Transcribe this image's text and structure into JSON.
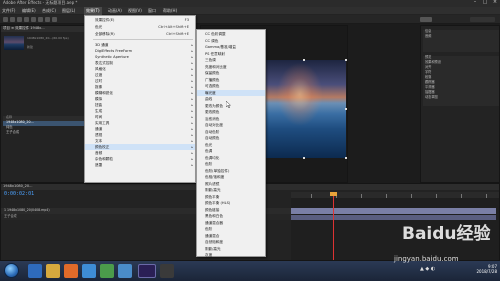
{
  "titlebar": {
    "title": "Adobe After Effects - 无标题项目.aep *"
  },
  "menubar": {
    "items": [
      "文件(F)",
      "编辑(E)",
      "合成(C)",
      "图层(L)",
      "效果(T)",
      "动画(A)",
      "视图(V)",
      "窗口",
      "帮助(H)"
    ],
    "active_index": 4
  },
  "project": {
    "header": "项目 ≡   效果控件 1948x...",
    "info": "1948x1080_20...(60.00 fps)",
    "title_line": "新建",
    "rows_header": "名称",
    "rows": [
      "1948x1080_20...",
      "纯色",
      "王子合成"
    ]
  },
  "timeline": {
    "timecode": "0:00:02:01",
    "tab": "1948x1080_20...",
    "layer1": "1  1948x1080_20(0408.mp4)",
    "layer2": "王子合成"
  },
  "right_panel": {
    "header1": "信息",
    "header2": "音频",
    "rows": [
      "预览",
      "效果和预设",
      "对齐",
      "字符",
      "段落",
      "跟踪器",
      "平滑器",
      "摇摆器",
      "动态草图"
    ]
  },
  "effect_menu": {
    "items": [
      {
        "label": "效果控件(E)",
        "shortcut": "F3",
        "arrow": false
      },
      {
        "label": "色光",
        "shortcut": "Ctrl+Alt+Shift+E",
        "arrow": false
      },
      {
        "label": "全部移除(R)",
        "shortcut": "Ctrl+Shift+E",
        "arrow": false
      },
      {
        "label": "3D 通道",
        "shortcut": "",
        "arrow": true
      },
      {
        "label": "DigiEffects FreeForm",
        "shortcut": "",
        "arrow": true
      },
      {
        "label": "Synthetic Aperture",
        "shortcut": "",
        "arrow": true
      },
      {
        "label": "表达式控制",
        "shortcut": "",
        "arrow": true
      },
      {
        "label": "风格化",
        "shortcut": "",
        "arrow": true
      },
      {
        "label": "过渡",
        "shortcut": "",
        "arrow": true
      },
      {
        "label": "过时",
        "shortcut": "",
        "arrow": true
      },
      {
        "label": "抠像",
        "shortcut": "",
        "arrow": true
      },
      {
        "label": "模糊和锐化",
        "shortcut": "",
        "arrow": true
      },
      {
        "label": "模拟",
        "shortcut": "",
        "arrow": true
      },
      {
        "label": "扭曲",
        "shortcut": "",
        "arrow": true
      },
      {
        "label": "生成",
        "shortcut": "",
        "arrow": true
      },
      {
        "label": "时间",
        "shortcut": "",
        "arrow": true
      },
      {
        "label": "实用工具",
        "shortcut": "",
        "arrow": true
      },
      {
        "label": "通道",
        "shortcut": "",
        "arrow": true
      },
      {
        "label": "透视",
        "shortcut": "",
        "arrow": true
      },
      {
        "label": "文本",
        "shortcut": "",
        "arrow": true
      },
      {
        "label": "颜色校正",
        "shortcut": "",
        "arrow": true
      },
      {
        "label": "音频",
        "shortcut": "",
        "arrow": true
      },
      {
        "label": "杂色和颗粒",
        "shortcut": "",
        "arrow": true
      },
      {
        "label": "遮罩",
        "shortcut": "",
        "arrow": true
      }
    ],
    "highlight_index": 20
  },
  "color_menu": {
    "items": [
      "CC 色彩调整",
      "CC 调色",
      "Gamma/基准/增益",
      "PS 任意映射",
      "三色调",
      "亮度和对比度",
      "保留颜色",
      "广播颜色",
      "可选颜色",
      "曝光度",
      "曲线",
      "更改为颜色",
      "更改颜色",
      "治愈消色",
      "自动对比度",
      "自动色阶",
      "自动颜色",
      "色光",
      "色调",
      "色调均化",
      "色阶",
      "色阶(单独控件)",
      "色相/饱和度",
      "照片滤镜",
      "阴影/高光",
      "颜色平衡",
      "颜色平衡 (HLS)",
      "颜色链接",
      "黑色和白色",
      "通道混合器",
      "色阶",
      "通道混合",
      "自然饱和度",
      "阴影/高光",
      "灰度"
    ],
    "highlight_index": 9
  },
  "taskbar": {
    "time": "9:07",
    "date": "2018/7/28"
  },
  "watermark": {
    "logo": "Baidu经验",
    "url": "jingyan.baidu.com"
  },
  "colors": {
    "accent": "#4da3ff",
    "menu_bg": "#f0f0f0",
    "menu_highlight": "#cfe2f7",
    "playhead": "#dd3333"
  }
}
